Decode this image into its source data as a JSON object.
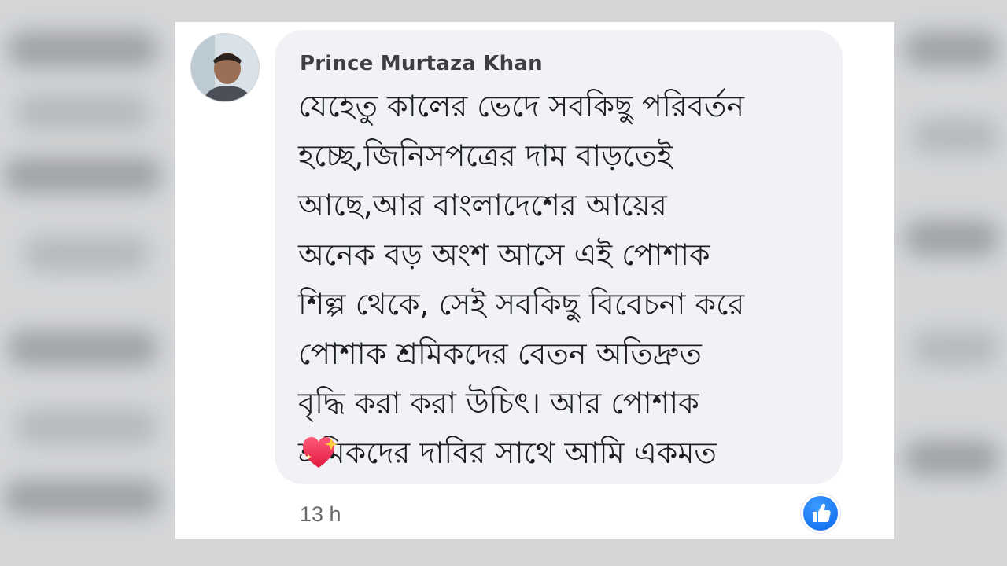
{
  "comment": {
    "author_name": "Prince Murtaza Khan",
    "text": "যেহেতু কালের ভেদে সবকিছু পরিবর্তন\nহচ্ছে,জিনিসপত্রের দাম বাড়তেই\nআছে,আর বাংলাদেশের আয়ের\nঅনেক বড় অংশ আসে এই পোশাক\nশিল্প থেকে, সেই সবকিছু বিবেচনা করে\nপোশাক শ্রমিকদের বেতন অতিদ্রুত\nবৃদ্ধি করা করা উচিৎ। আর পোশাক\nশ্রমিকদের দাবির সাথে আমি একমত",
    "emoji": "sparkling-heart-icon",
    "timestamp": "13 h",
    "reaction": "like-icon"
  },
  "colors": {
    "bubble": "#f0f2f5",
    "author": "#3c3e42",
    "text": "#1c1e21",
    "timestamp": "#65676b",
    "like": "#1877f2"
  }
}
